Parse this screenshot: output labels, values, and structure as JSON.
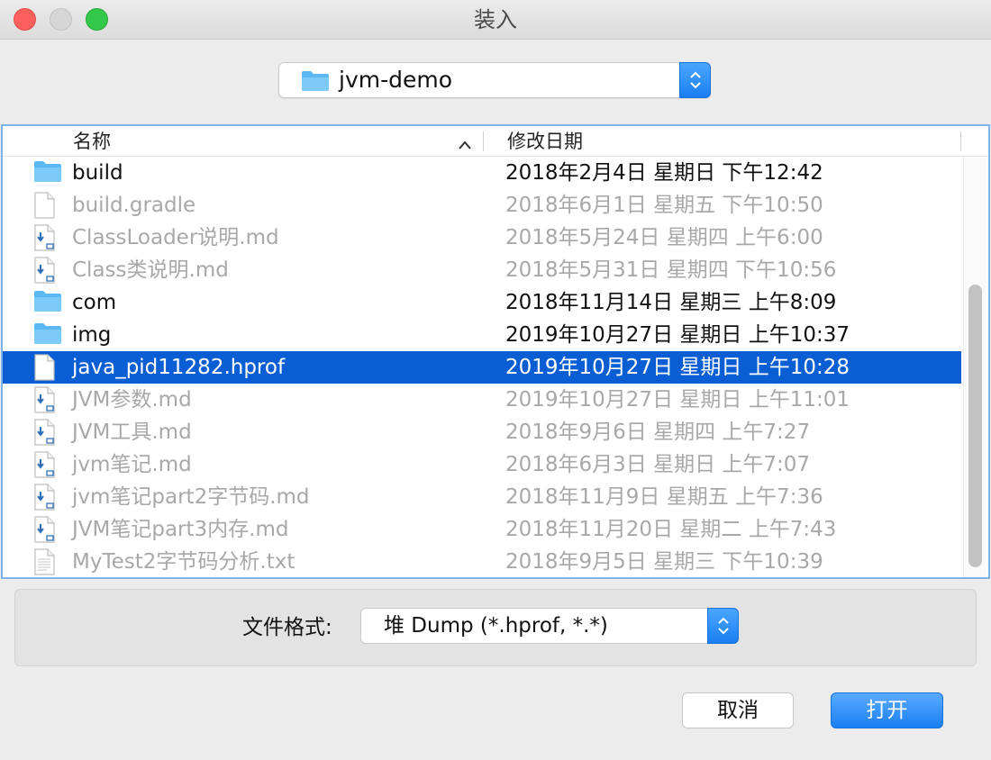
{
  "window": {
    "title": "装入"
  },
  "location": {
    "folder_name": "jvm-demo",
    "icon": "folder-icon"
  },
  "columns": {
    "name": "名称",
    "date_modified": "修改日期",
    "sort_icon": "chevron-up-icon"
  },
  "files": [
    {
      "name": "build",
      "date": "2018年2月4日 星期日 下午12:42",
      "icon": "folder-icon",
      "state": "bold"
    },
    {
      "name": "build.gradle",
      "date": "2018年6月1日 星期五 下午10:50",
      "icon": "document-icon",
      "state": "dim"
    },
    {
      "name": "ClassLoader说明.md",
      "date": "2018年5月24日 星期四 上午6:00",
      "icon": "markdown-file-icon",
      "state": "dim"
    },
    {
      "name": "Class类说明.md",
      "date": "2018年5月31日 星期四 下午10:56",
      "icon": "markdown-file-icon",
      "state": "dim"
    },
    {
      "name": "com",
      "date": "2018年11月14日 星期三 上午8:09",
      "icon": "folder-icon",
      "state": "bold"
    },
    {
      "name": "img",
      "date": "2019年10月27日 星期日 上午10:37",
      "icon": "folder-icon",
      "state": "bold"
    },
    {
      "name": "java_pid11282.hprof",
      "date": "2019年10月27日 星期日 上午10:28",
      "icon": "document-icon",
      "state": "selected"
    },
    {
      "name": "JVM参数.md",
      "date": "2019年10月27日 星期日 上午11:01",
      "icon": "markdown-file-icon",
      "state": "dim"
    },
    {
      "name": "JVM工具.md",
      "date": "2018年9月6日 星期四 上午7:27",
      "icon": "markdown-file-icon",
      "state": "dim"
    },
    {
      "name": "jvm笔记.md",
      "date": "2018年6月3日 星期日 上午7:07",
      "icon": "markdown-file-icon",
      "state": "dim"
    },
    {
      "name": "jvm笔记part2字节码.md",
      "date": "2018年11月9日 星期五 上午7:36",
      "icon": "markdown-file-icon",
      "state": "dim"
    },
    {
      "name": "JVM笔记part3内存.md",
      "date": "2018年11月20日 星期二 上午7:43",
      "icon": "markdown-file-icon",
      "state": "dim"
    },
    {
      "name": "MyTest2字节码分析.txt",
      "date": "2018年9月5日 星期三 下午10:39",
      "icon": "text-file-icon",
      "state": "dim"
    }
  ],
  "format": {
    "label": "文件格式:",
    "value": "堆 Dump (*.hprof, *.*)"
  },
  "buttons": {
    "cancel": "取消",
    "open": "打开"
  },
  "colors": {
    "selection": "#0a5ed3",
    "accent": "#1b7ff1",
    "folder": "#5cb8f2"
  }
}
